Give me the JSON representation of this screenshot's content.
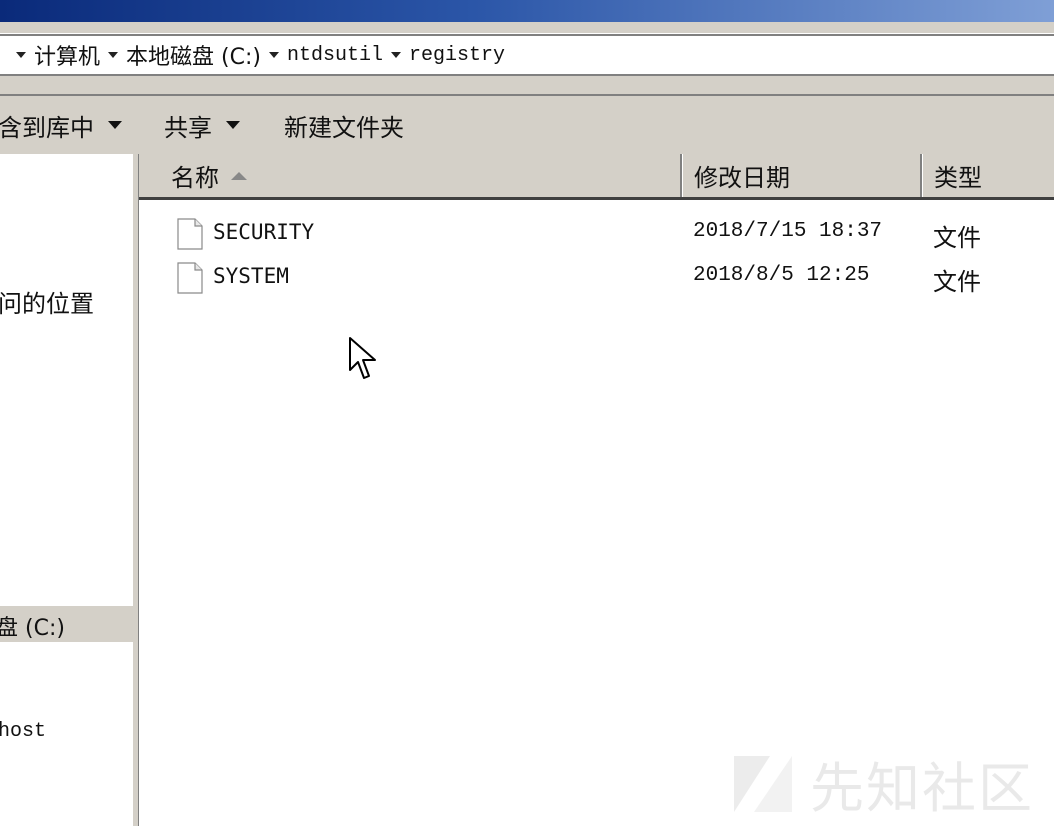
{
  "breadcrumb": {
    "items": [
      "计算机",
      "本地磁盘 (C:)",
      "ntdsutil",
      "registry"
    ]
  },
  "toolbar": {
    "include_library_label": "含到库中",
    "share_label": "共享",
    "new_folder_label": "新建文件夹"
  },
  "nav": {
    "recent_places_label": "问的位置",
    "local_disk_label": "盘 (C:)",
    "host_label": "host"
  },
  "columns": {
    "name": "名称",
    "date": "修改日期",
    "type": "类型"
  },
  "files": [
    {
      "name": "SECURITY",
      "modified": "2018/7/15 18:37",
      "type": "文件"
    },
    {
      "name": "SYSTEM",
      "modified": "2018/8/5 12:25",
      "type": "文件"
    }
  ],
  "watermark": {
    "text": "先知社区"
  },
  "icons": {
    "file": "file-icon",
    "cursor": "mouse-cursor-icon",
    "sort": "sort-ascending-icon"
  }
}
